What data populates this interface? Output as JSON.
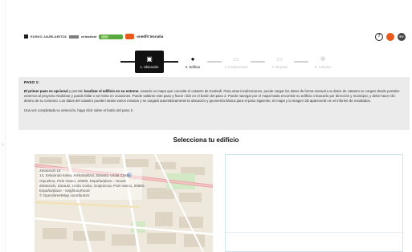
{
  "header": {
    "logos": {
      "logo1": "EUSKO JAURLARITZA",
      "logo2": "ekibaltzat",
      "brand": "onedfit tecnalia"
    },
    "icons": {
      "help": "?",
      "user": "EV"
    }
  },
  "stepper": {
    "steps": [
      {
        "label": "1. Ubicación",
        "icon": "location-pin-icon",
        "glyph": "▣",
        "state": "active"
      },
      {
        "label": "2. Edificio",
        "icon": "building-icon",
        "glyph": "●",
        "state": "enabled"
      },
      {
        "label": "3. Instalaciones",
        "icon": "installations-icon",
        "glyph": "▭",
        "state": "disabled"
      },
      {
        "label": "4. Mejoras",
        "icon": "improvements-icon",
        "glyph": "▭",
        "state": "disabled"
      },
      {
        "label": "5. Calcular",
        "icon": "gear-icon",
        "glyph": "✲",
        "state": "disabled"
      }
    ]
  },
  "info": {
    "title": "PASO 1:",
    "lead_bold_1": "El primer paso es opcional",
    "lead_text_1": " y permite ",
    "lead_bold_2": "localizar el edificio en su entorno",
    "body": ", usando un mapa que consulta el catastro de Euskadi. Para otras localizaciones, puede cargar los datos de forma manual.Los datos de catastro se cargan desde portales externos al proyecto Akobitzar y puede fallar o ser lento en ocasiones. Puede saltarse este paso y hacer click en el botón del paso 2. Puede navegar por el mapa hasta encontrar su edificio o buscarlo por dirección y municipio, y debe hacer clic dentro de su contorno. Los datos del catastro pueden tardar varios minutos y se cargará automáticamente la ubicación y geometría básica para el paso siguiente. El mapa y la imagen 3D aparecerán en el informe de resultados.",
    "note": "Una vez completada su selección, haga click sobre el botón del paso 2."
  },
  "main": {
    "section_title": "Selecciona tu edificio"
  },
  "map": {
    "popup_lines": [
      "Zelaiondo 14",
      "14, Zelaiondo kalea, Arrikobaltzal, Zarautz, Urola Costa,",
      "Gipuzkoa, País Vasco, 20800, España/place - House",
      "Zelaiondo, Zarautz, Urola Costa, Guipúzcoa, País Vasco, 20800,",
      "España/place - neighbourhood",
      "© OpenStreetMap contributors"
    ]
  },
  "colors": {
    "accent": "#111111",
    "notification": "#e8591c",
    "logo_green": "#58a83d",
    "info_bg": "#ebebeb",
    "map_road": "#e8a7a7",
    "map_green": "#d3e8c4"
  }
}
